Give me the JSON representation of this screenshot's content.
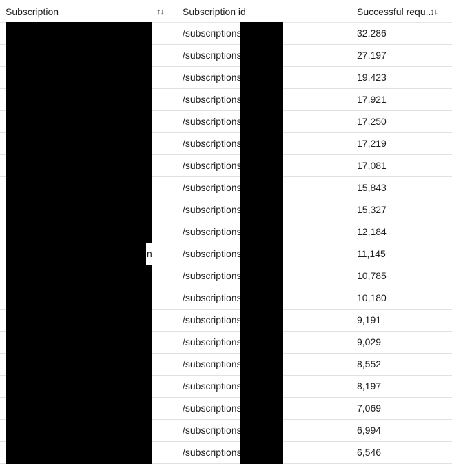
{
  "table": {
    "columns": [
      {
        "id": "subscription",
        "label": "Subscription",
        "sortable": true,
        "sort_icon": "sort-ascending-descending-icon",
        "sort_glyph": "↑↓"
      },
      {
        "id": "subscription_id",
        "label": "Subscription id",
        "sortable": false,
        "sort_icon": "",
        "sort_glyph": ""
      },
      {
        "id": "successful_requests",
        "label": "Successful requ...",
        "sortable": true,
        "sort_icon": "sort-ascending-descending-icon",
        "sort_glyph": "↑↓"
      }
    ],
    "rows": [
      {
        "subscription": "",
        "subscription_id": "/subscriptions,",
        "successful_requests": "32,286",
        "leak": ""
      },
      {
        "subscription": "",
        "subscription_id": "/subscriptions,",
        "successful_requests": "27,197",
        "leak": ""
      },
      {
        "subscription": "",
        "subscription_id": "/subscriptions,",
        "successful_requests": "19,423",
        "leak": ""
      },
      {
        "subscription": "",
        "subscription_id": "/subscriptions,",
        "successful_requests": "17,921",
        "leak": ""
      },
      {
        "subscription": "",
        "subscription_id": "/subscriptions,",
        "successful_requests": "17,250",
        "leak": ""
      },
      {
        "subscription": "",
        "subscription_id": "/subscriptions,",
        "successful_requests": "17,219",
        "leak": ""
      },
      {
        "subscription": "",
        "subscription_id": "/subscriptions,",
        "successful_requests": "17,081",
        "leak": ""
      },
      {
        "subscription": "",
        "subscription_id": "/subscriptions,",
        "successful_requests": "15,843",
        "leak": ""
      },
      {
        "subscription": "",
        "subscription_id": "/subscriptions,",
        "successful_requests": "15,327",
        "leak": ""
      },
      {
        "subscription": "",
        "subscription_id": "/subscriptions,",
        "successful_requests": "12,184",
        "leak": ""
      },
      {
        "subscription": "",
        "subscription_id": "/subscriptions,",
        "successful_requests": "11,145",
        "leak": "n"
      },
      {
        "subscription": "",
        "subscription_id": "/subscriptions,",
        "successful_requests": "10,785",
        "leak": ""
      },
      {
        "subscription": "",
        "subscription_id": "/subscriptions,",
        "successful_requests": "10,180",
        "leak": ""
      },
      {
        "subscription": "",
        "subscription_id": "/subscriptions,",
        "successful_requests": "9,191",
        "leak": ""
      },
      {
        "subscription": "",
        "subscription_id": "/subscriptions,",
        "successful_requests": "9,029",
        "leak": ""
      },
      {
        "subscription": "",
        "subscription_id": "/subscriptions,",
        "successful_requests": "8,552",
        "leak": ""
      },
      {
        "subscription": "",
        "subscription_id": "/subscriptions,",
        "successful_requests": "8,197",
        "leak": ""
      },
      {
        "subscription": "",
        "subscription_id": "/subscriptions,",
        "successful_requests": "7,069",
        "leak": ""
      },
      {
        "subscription": "",
        "subscription_id": "/subscriptions,",
        "successful_requests": "6,994",
        "leak": ""
      },
      {
        "subscription": "",
        "subscription_id": "/subscriptions,",
        "successful_requests": "6,546",
        "leak": ""
      }
    ]
  },
  "colors": {
    "text": "#201f1e",
    "row_divider": "#e1e1e1",
    "header_divider": "#e6e6e6",
    "redaction": "#000000",
    "background": "#ffffff"
  }
}
